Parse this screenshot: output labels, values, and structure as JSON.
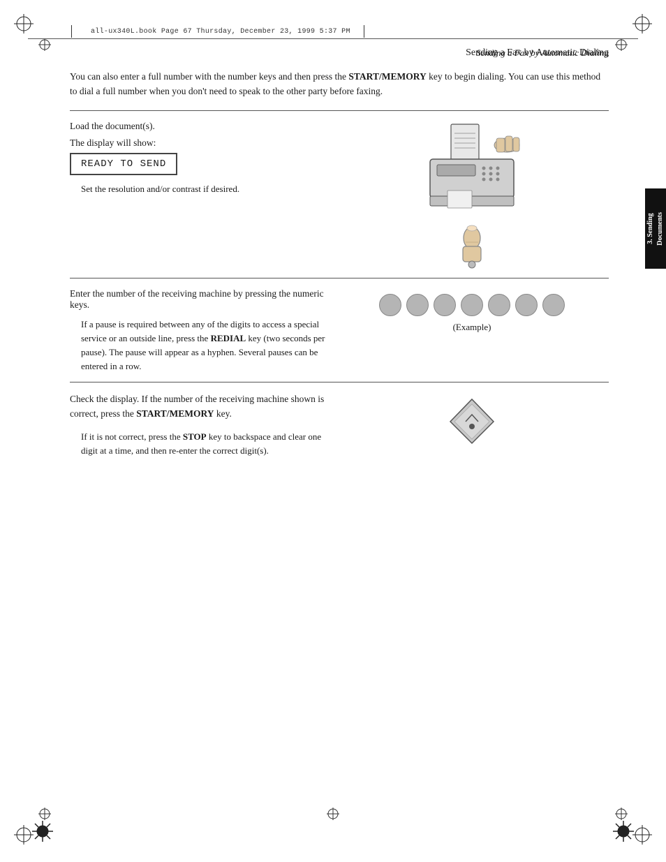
{
  "page": {
    "title": "Sending a Fax by Automatic Dialing",
    "file_info": "all-ux340L.book   Page 67   Thursday, December 23, 1999   5:37 PM"
  },
  "intro": {
    "text1": "You can also enter a full number with the number keys and then press",
    "text2": "the ",
    "bold1": "START/MEMORY",
    "text3": " key to begin dialing. You can use this method",
    "text4": "to dial a full number when you don’t need to speak to the other party",
    "text5": "before faxing."
  },
  "steps": [
    {
      "id": "step1",
      "main_text": "Load the document(s).",
      "sub_text": "The display will show:",
      "display": "READY TO SEND",
      "note": "Set the resolution and/or contrast if desired.",
      "has_fax_image": true,
      "has_finger_image": true
    },
    {
      "id": "step2",
      "main_text": "Enter the number of the receiving machine by pressing the numeric keys.",
      "note_bold": "If a pause is required between any of the digits to access a special service or an outside line, press the ",
      "redial_bold": "REDIAL",
      "note_rest": " key (two seconds per pause). The pause will appear as a hyphen. Several pauses can be entered in a row.",
      "example_label": "(Example)",
      "has_numeric_keys": true
    },
    {
      "id": "step3",
      "main_text": "Check the display. If the number of the receiving machine shown is correct, press the ",
      "bold_start": "START/",
      "bold_memory": "MEMORY",
      "text_end": " key.",
      "note_start": "If it is not correct, press the ",
      "bold_stop": "STOP",
      "note_end": " key to backspace and clear one digit at a time, and then re-enter the correct digit(s).",
      "has_key_image": true
    }
  ],
  "side_tab": {
    "line1": "3. Sending",
    "line2": "Documents"
  }
}
